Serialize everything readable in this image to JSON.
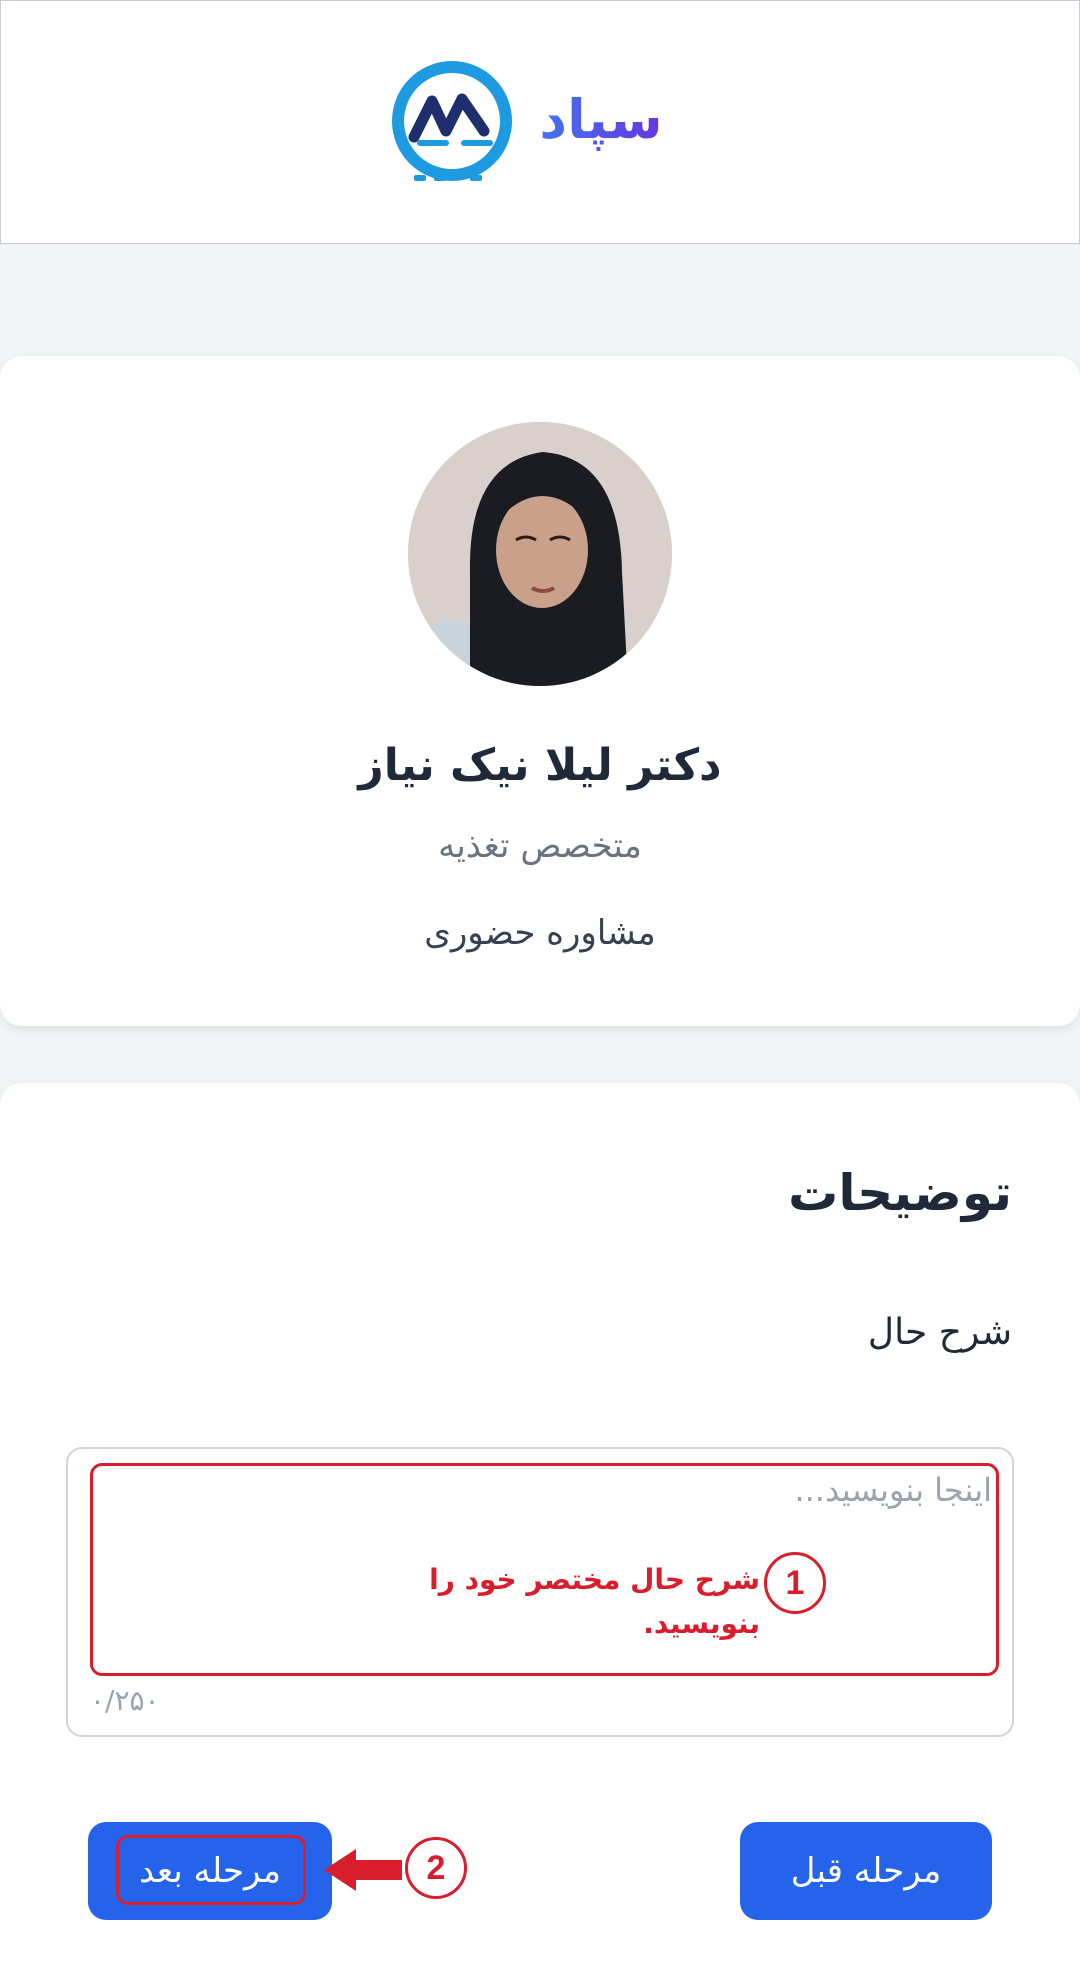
{
  "header": {
    "logo_text": "سپاد",
    "logo_icon": "sepad-logo-icon"
  },
  "doctor": {
    "name": "دکتر لیلا نیک نیاز",
    "specialty": "متخصص تغذیه",
    "consultation_type": "مشاوره حضوری",
    "avatar_icon": "doctor-avatar-photo"
  },
  "description": {
    "title": "توضیحات",
    "field_label": "شرح حال",
    "placeholder": "اینجا بنویسید...",
    "value": "",
    "counter": "۰/۲۵۰"
  },
  "annotations": {
    "step1_number": "1",
    "step1_text": "شرح حال مختصر خود را بنویسید.",
    "step2_number": "2"
  },
  "buttons": {
    "next_label": "مرحله بعد",
    "prev_label": "مرحله قبل"
  },
  "colors": {
    "primary": "#2563eb",
    "annotation_red": "#d81e2c",
    "logo_blue": "#1e9be0",
    "logo_purple": "#6d28d9"
  }
}
